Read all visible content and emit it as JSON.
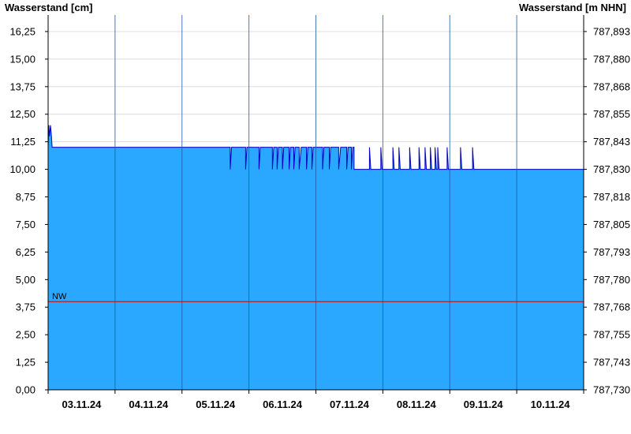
{
  "chart_data": {
    "type": "area",
    "ylabel_left": "Wasserstand [cm]",
    "ylabel_right": "Wasserstand [m NHN]",
    "ylim": [
      0,
      17
    ],
    "y_ticks": [
      "0,00",
      "1,25",
      "2,50",
      "3,75",
      "5,00",
      "6,25",
      "7,50",
      "8,75",
      "10,00",
      "11,25",
      "12,50",
      "13,75",
      "15,00",
      "16,25"
    ],
    "y_ticks_right": [
      "787,730",
      "787,743",
      "787,755",
      "787,768",
      "787,780",
      "787,793",
      "787,805",
      "787,818",
      "787,830",
      "787,843",
      "787,855",
      "787,868",
      "787,880",
      "787,893"
    ],
    "x_ticks": [
      "03.11.24",
      "04.11.24",
      "05.11.24",
      "06.11.24",
      "07.11.24",
      "08.11.24",
      "09.11.24",
      "10.11.24"
    ],
    "x_range_days": [
      0,
      8
    ],
    "reference_line": {
      "label": "NW",
      "value": 4.0,
      "color": "#cc0000"
    },
    "series": [
      {
        "color": "#2aa8ff",
        "line_color": "#0000c8",
        "points": [
          [
            0.0,
            11
          ],
          [
            0.01,
            12
          ],
          [
            0.02,
            11.5
          ],
          [
            0.035,
            12
          ],
          [
            0.05,
            11.5
          ],
          [
            0.06,
            11
          ],
          [
            2.72,
            11
          ],
          [
            2.72,
            10
          ],
          [
            2.74,
            11
          ],
          [
            2.95,
            11
          ],
          [
            2.95,
            10
          ],
          [
            2.97,
            11
          ],
          [
            3.15,
            11
          ],
          [
            3.15,
            10
          ],
          [
            3.17,
            11
          ],
          [
            3.35,
            11
          ],
          [
            3.35,
            10
          ],
          [
            3.37,
            11
          ],
          [
            3.42,
            11
          ],
          [
            3.42,
            10
          ],
          [
            3.44,
            11
          ],
          [
            3.5,
            11
          ],
          [
            3.5,
            10
          ],
          [
            3.52,
            11
          ],
          [
            3.6,
            11
          ],
          [
            3.6,
            10
          ],
          [
            3.62,
            11
          ],
          [
            3.67,
            11
          ],
          [
            3.67,
            10
          ],
          [
            3.69,
            11
          ],
          [
            3.75,
            11
          ],
          [
            3.75,
            10
          ],
          [
            3.78,
            11
          ],
          [
            3.86,
            11
          ],
          [
            3.86,
            10
          ],
          [
            3.88,
            11
          ],
          [
            3.94,
            11
          ],
          [
            3.94,
            10
          ],
          [
            3.96,
            11
          ],
          [
            4.1,
            11
          ],
          [
            4.1,
            10
          ],
          [
            4.12,
            11
          ],
          [
            4.2,
            11
          ],
          [
            4.2,
            10
          ],
          [
            4.22,
            11
          ],
          [
            4.34,
            11
          ],
          [
            4.34,
            10
          ],
          [
            4.37,
            11
          ],
          [
            4.46,
            11
          ],
          [
            4.46,
            10
          ],
          [
            4.48,
            11
          ],
          [
            4.53,
            11
          ],
          [
            4.53,
            10
          ],
          [
            4.55,
            11
          ],
          [
            4.57,
            11
          ],
          [
            4.57,
            10
          ],
          [
            4.8,
            10
          ],
          [
            4.8,
            11
          ],
          [
            4.82,
            10
          ],
          [
            4.97,
            10
          ],
          [
            4.97,
            11
          ],
          [
            4.99,
            10
          ],
          [
            5.15,
            10
          ],
          [
            5.15,
            11
          ],
          [
            5.17,
            10
          ],
          [
            5.24,
            10
          ],
          [
            5.24,
            11
          ],
          [
            5.26,
            10
          ],
          [
            5.4,
            10
          ],
          [
            5.4,
            11
          ],
          [
            5.42,
            10
          ],
          [
            5.54,
            10
          ],
          [
            5.54,
            11
          ],
          [
            5.56,
            10
          ],
          [
            5.63,
            10
          ],
          [
            5.63,
            11
          ],
          [
            5.65,
            10
          ],
          [
            5.71,
            10
          ],
          [
            5.71,
            11
          ],
          [
            5.73,
            10
          ],
          [
            5.78,
            10
          ],
          [
            5.78,
            11
          ],
          [
            5.8,
            10
          ],
          [
            5.82,
            10
          ],
          [
            5.82,
            11
          ],
          [
            5.84,
            10
          ],
          [
            5.96,
            10
          ],
          [
            5.96,
            11
          ],
          [
            5.98,
            10
          ],
          [
            6.16,
            10
          ],
          [
            6.16,
            11
          ],
          [
            6.18,
            10
          ],
          [
            6.34,
            10
          ],
          [
            6.34,
            11
          ],
          [
            6.36,
            10
          ],
          [
            8.0,
            10
          ]
        ]
      }
    ],
    "grid": true
  }
}
